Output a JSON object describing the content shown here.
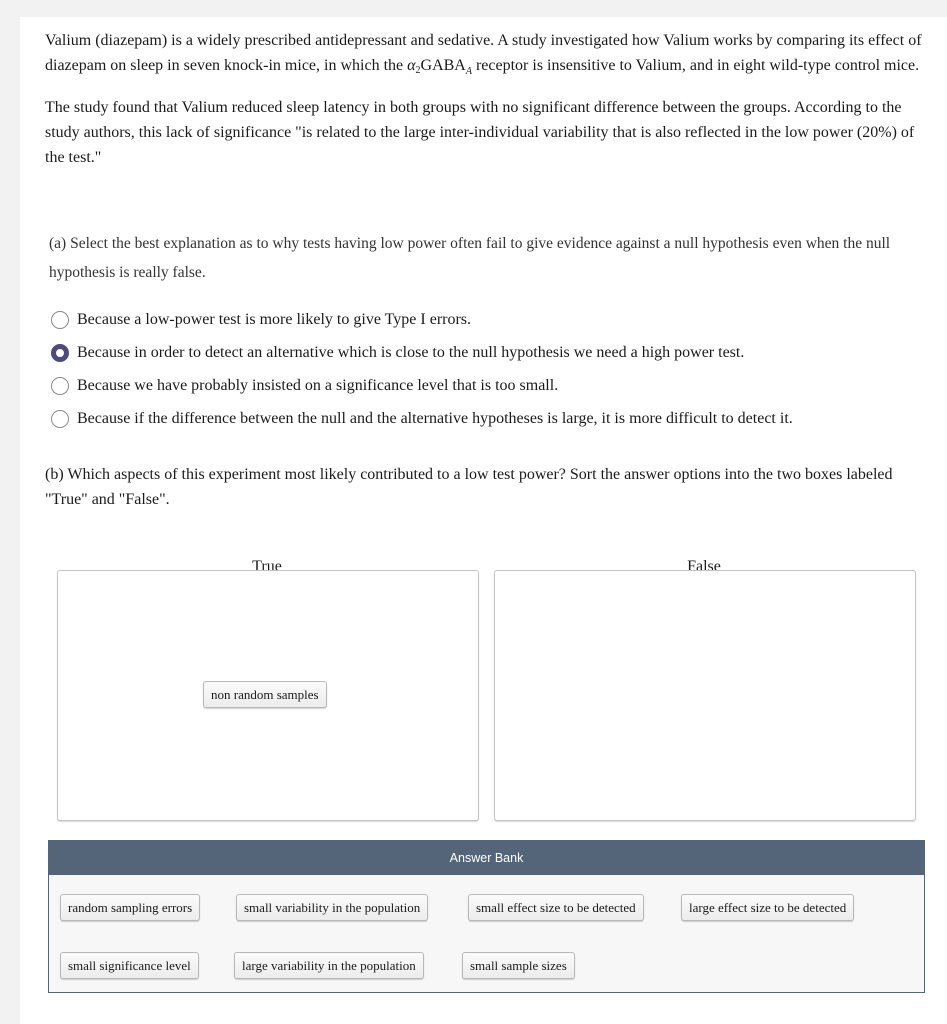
{
  "intro": {
    "p1_before": "Valium (diazepam) is a widely prescribed antidepressant and sedative. A study investigated how Valium works by comparing its effect of diazepam on sleep in seven knock-in mice, in which the ",
    "p1_alpha": "α",
    "p1_alpha_sub": "2",
    "p1_gaba": "GABA",
    "p1_gaba_sub": "A",
    "p1_after": " receptor is insensitive to Valium, and in eight wild-type control mice.",
    "p2": "The study found that Valium reduced sleep latency in both groups with no significant difference between the groups. According to the study authors, this lack of significance \"is related to the large inter-individual variability that is also reflected in the low power (20%) of the test.\""
  },
  "part_a": {
    "question": "(a) Select the best explanation as to why tests having low power often fail to give evidence against a null hypothesis even when the null hypothesis is really false.",
    "options": [
      {
        "label": "Because a low-power test is more likely to give Type I errors.",
        "selected": false
      },
      {
        "label": "Because in order to detect an alternative which is close to the null hypothesis we need a high power test.",
        "selected": true
      },
      {
        "label": "Because we have probably insisted on a significance level that is too small.",
        "selected": false
      },
      {
        "label": "Because if the difference between the null and the alternative hypotheses is large, it is more difficult to detect it.",
        "selected": false
      }
    ]
  },
  "part_b": {
    "question": "(b) Which aspects of this experiment most likely contributed to a low test power? Sort the answer options into the two boxes labeled \"True\" and \"False\".",
    "bins": [
      {
        "title": "True",
        "items": [
          "non random samples"
        ]
      },
      {
        "title": "False",
        "items": []
      }
    ],
    "answer_bank": {
      "title": "Answer Bank",
      "items": [
        "random sampling errors",
        "small variability in the population",
        "small effect size to be detected",
        "large effect size to be detected",
        "small significance level",
        "large variability in the population",
        "small sample sizes"
      ]
    }
  },
  "colors": {
    "radio_selected": "#4d4a7d",
    "bank_header": "#54657a"
  }
}
